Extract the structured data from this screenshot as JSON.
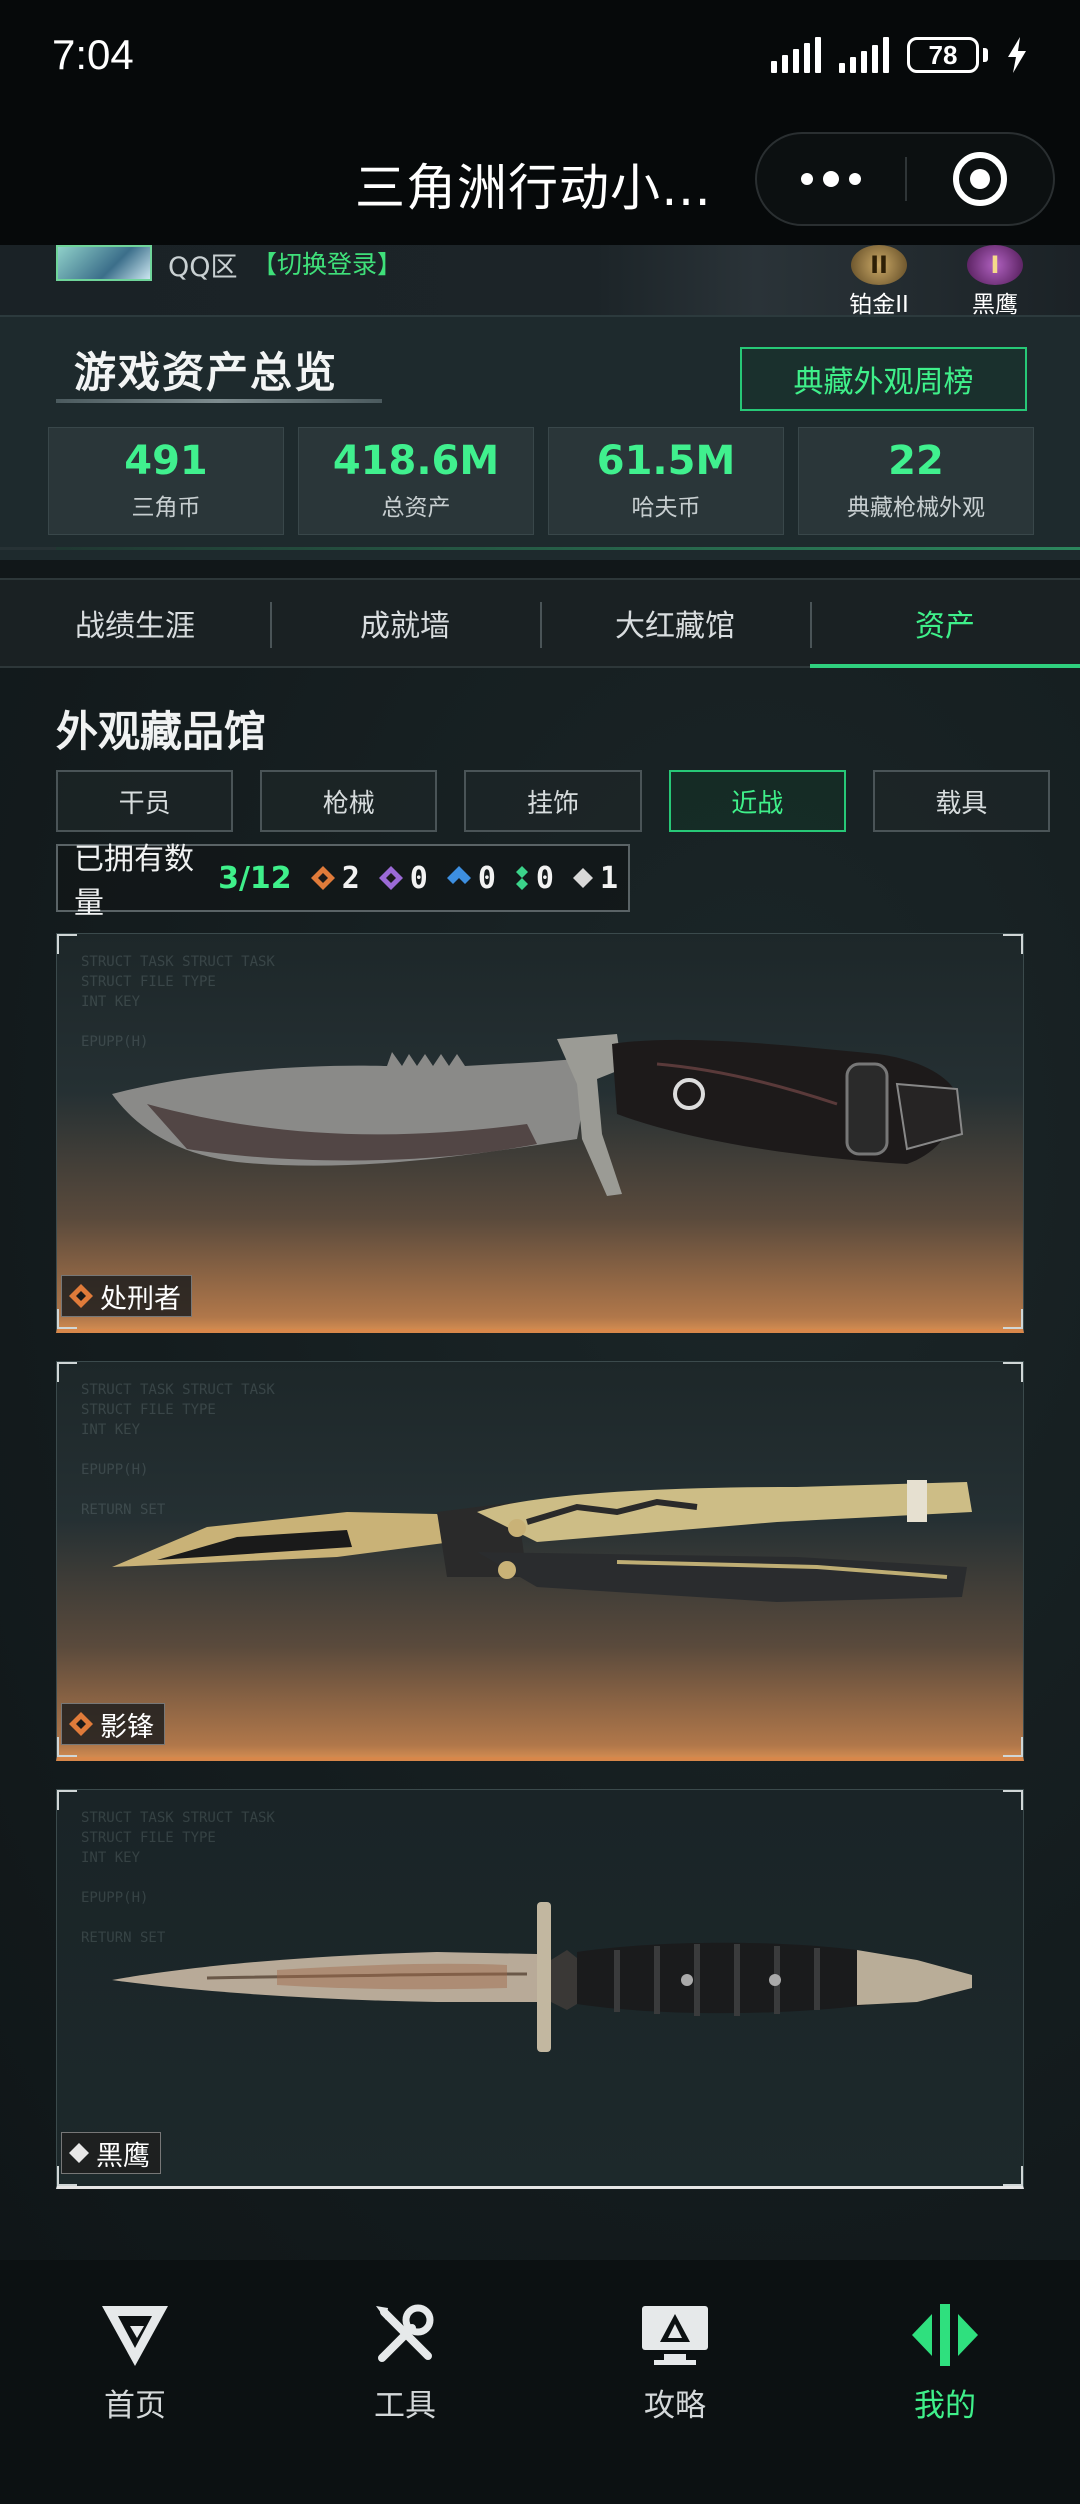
{
  "status": {
    "time": "7:04",
    "battery": "78"
  },
  "titlebar": {
    "title": "三角洲行动小…"
  },
  "profile": {
    "zone": "QQ区",
    "switch_login": "【切换登录】",
    "rank1_num": "II",
    "rank1_label": "铂金II",
    "rank2_num": "I",
    "rank2_label": "黑鹰"
  },
  "overview": {
    "title": "游戏资产总览",
    "top_button": "典藏外观周榜",
    "stats": [
      {
        "value": "491",
        "label": "三角币"
      },
      {
        "value": "418.6M",
        "label": "总资产"
      },
      {
        "value": "61.5M",
        "label": "哈夫币"
      },
      {
        "value": "22",
        "label": "典藏枪械外观"
      }
    ]
  },
  "tabs": [
    {
      "label": "战绩生涯"
    },
    {
      "label": "成就墙"
    },
    {
      "label": "大红藏馆"
    },
    {
      "label": "资产"
    }
  ],
  "section": {
    "title": "外观藏品馆",
    "filters": [
      {
        "label": "干员"
      },
      {
        "label": "枪械"
      },
      {
        "label": "挂饰"
      },
      {
        "label": "近战"
      },
      {
        "label": "载具"
      }
    ],
    "owned_label": "已拥有数量",
    "owned_count": "3/12",
    "rarity_counts": [
      {
        "count": "2",
        "color": "#e07b3a"
      },
      {
        "count": "0",
        "color": "#9b6ad6"
      },
      {
        "count": "0",
        "color": "#3d8fe0"
      },
      {
        "count": "0",
        "color": "#3bd38a"
      },
      {
        "count": "1",
        "color": "#d8d8d8"
      }
    ]
  },
  "items": [
    {
      "name": "处刑者",
      "rarity_color": "#e07b3a"
    },
    {
      "name": "影锋",
      "rarity_color": "#e07b3a"
    },
    {
      "name": "黑鹰",
      "rarity_color": "#e8e8e8"
    }
  ],
  "bottom_nav": [
    {
      "label": "首页",
      "icon": "home-logo-icon"
    },
    {
      "label": "工具",
      "icon": "tools-icon"
    },
    {
      "label": "攻略",
      "icon": "guide-icon"
    },
    {
      "label": "我的",
      "icon": "profile-logo-icon"
    }
  ],
  "colors": {
    "accent": "#3ff08a",
    "orange_rarity": "#e07b3a",
    "background": "#111719"
  }
}
